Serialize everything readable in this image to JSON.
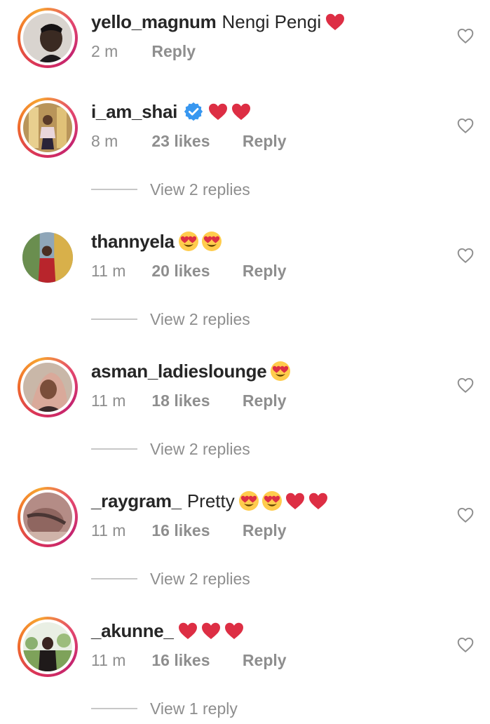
{
  "comments": [
    {
      "username": "yello_magnum",
      "text": "Nengi Pengi",
      "emojis": [
        "red-heart"
      ],
      "verified": false,
      "story_ring": true,
      "time": "2 m",
      "likes": "",
      "reply_label": "Reply",
      "view_replies": ""
    },
    {
      "username": "i_am_shai",
      "text": "",
      "emojis": [
        "red-heart",
        "red-heart"
      ],
      "verified": true,
      "story_ring": true,
      "time": "8 m",
      "likes": "23 likes",
      "reply_label": "Reply",
      "view_replies": "View 2 replies"
    },
    {
      "username": "thannyela",
      "text": "",
      "emojis": [
        "heart-eyes",
        "heart-eyes"
      ],
      "verified": false,
      "story_ring": false,
      "time": "11 m",
      "likes": "20 likes",
      "reply_label": "Reply",
      "view_replies": "View 2 replies"
    },
    {
      "username": "asman_ladieslounge",
      "text": "",
      "emojis": [
        "heart-eyes"
      ],
      "verified": false,
      "story_ring": true,
      "time": "11 m",
      "likes": "18 likes",
      "reply_label": "Reply",
      "view_replies": "View 2 replies"
    },
    {
      "username": "_raygram_",
      "text": "Pretty",
      "emojis": [
        "heart-eyes",
        "heart-eyes",
        "red-heart",
        "red-heart"
      ],
      "verified": false,
      "story_ring": true,
      "time": "11 m",
      "likes": "16 likes",
      "reply_label": "Reply",
      "view_replies": "View 2 replies"
    },
    {
      "username": "_akunne_",
      "text": "",
      "emojis": [
        "red-heart",
        "red-heart",
        "red-heart"
      ],
      "verified": false,
      "story_ring": true,
      "time": "11 m",
      "likes": "16 likes",
      "reply_label": "Reply",
      "view_replies": "View 1 reply"
    }
  ],
  "icons": {
    "like": "heart-outline-icon",
    "verified": "verified-badge-icon"
  },
  "colors": {
    "username": "#262626",
    "meta": "#8e8e8e",
    "verified": "#3897f0",
    "heart_emoji": "#dd2e44",
    "story_ring_start": "#d8315b",
    "story_ring_end": "#f7a531"
  }
}
